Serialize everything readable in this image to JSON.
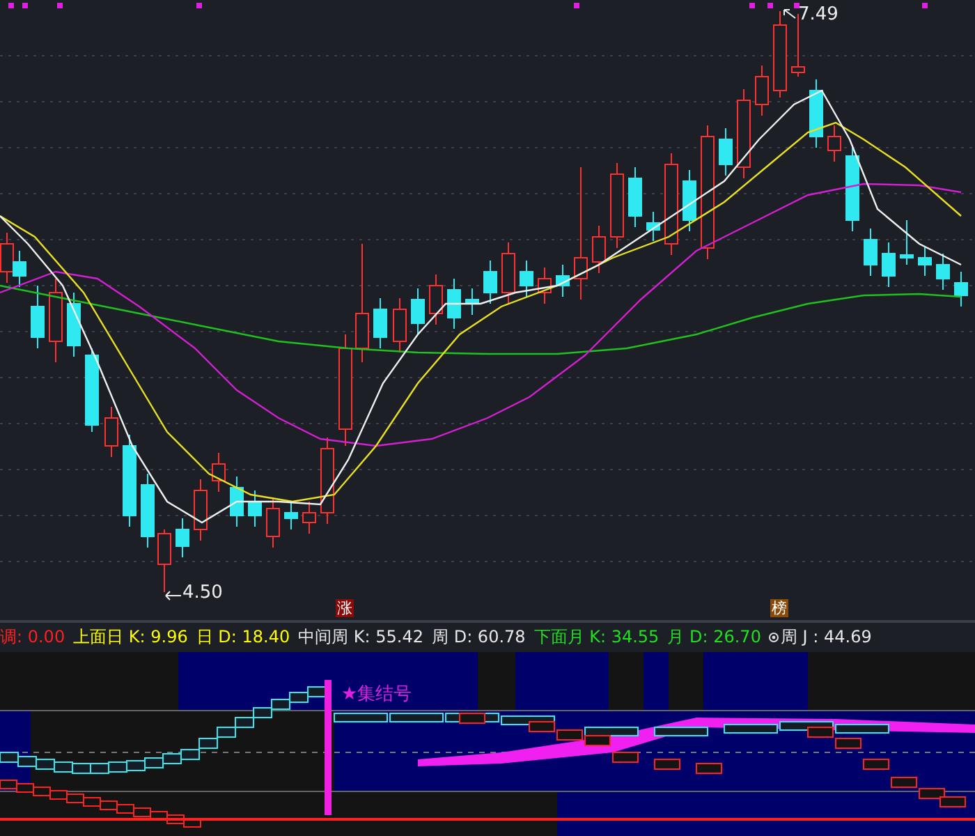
{
  "price_chart": {
    "high_label": "7.49",
    "low_label": "4.50",
    "tags": [
      {
        "text": "涨",
        "color": "#8b0a0a"
      },
      {
        "text": "榜",
        "color": "#8b4a0a"
      }
    ]
  },
  "indicator_bar": {
    "items": [
      {
        "label": "调:",
        "value": "0.00",
        "color": "#ff2020",
        "icon": false
      },
      {
        "label": "上面日 K:",
        "value": "9.96",
        "color": "#ffff00",
        "icon": false
      },
      {
        "label": "日 D:",
        "value": "18.40",
        "color": "#ffff00",
        "icon": false
      },
      {
        "label": "中间周 K:",
        "value": "55.42",
        "color": "#e8e8e8",
        "icon": false
      },
      {
        "label": "周 D:",
        "value": "60.78",
        "color": "#e8e8e8",
        "icon": false
      },
      {
        "label": "下面月 K:",
        "value": "34.55",
        "color": "#20e020",
        "icon": false
      },
      {
        "label": "月 D:",
        "value": "26.70",
        "color": "#20e020",
        "icon": false
      },
      {
        "label": "周 J :",
        "value": "44.69",
        "color": "#e8e8e8",
        "icon": true
      }
    ]
  },
  "lower_panel": {
    "signal_label": "★集结号"
  }
}
